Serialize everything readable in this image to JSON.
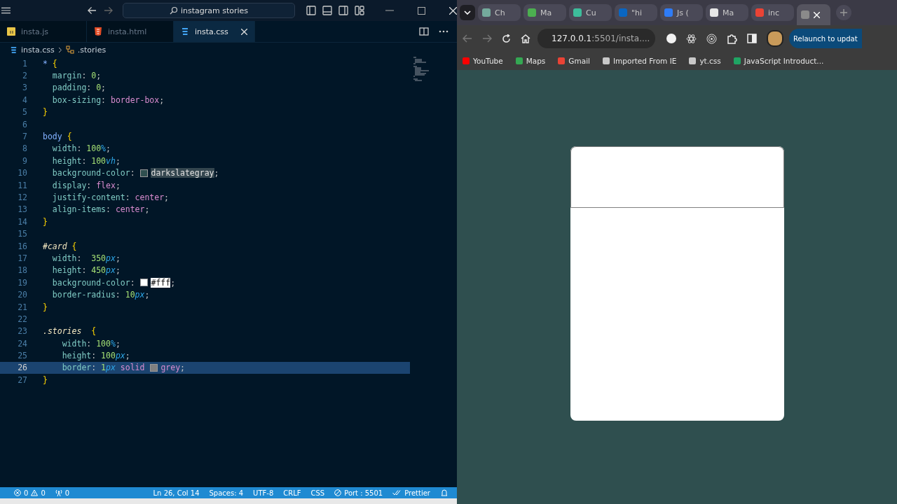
{
  "editor": {
    "search": "instagram stories",
    "tabs": [
      {
        "label": "insta.js",
        "kind": "js",
        "selected": false
      },
      {
        "label": "insta.html",
        "kind": "html",
        "selected": false
      },
      {
        "label": "insta.css",
        "kind": "css",
        "selected": true
      }
    ],
    "breadcrumb": {
      "file": "insta.css",
      "symbol": ".stories"
    },
    "lines": [
      {
        "num": "1",
        "selected": false,
        "tokens": [
          {
            "text": "*",
            "kind": "tag"
          },
          {
            "text": " {",
            "kind": "brace"
          }
        ]
      },
      {
        "num": "2",
        "selected": false,
        "tokens": [
          {
            "text": "  margin",
            "kind": "prop"
          },
          {
            "text": ": ",
            "kind": "punct"
          },
          {
            "text": "0",
            "kind": "num"
          },
          {
            "text": ";",
            "kind": "punct"
          }
        ]
      },
      {
        "num": "3",
        "selected": false,
        "tokens": [
          {
            "text": "  padding",
            "kind": "prop"
          },
          {
            "text": ": ",
            "kind": "punct"
          },
          {
            "text": "0",
            "kind": "num"
          },
          {
            "text": ";",
            "kind": "punct"
          }
        ]
      },
      {
        "num": "4",
        "selected": false,
        "tokens": [
          {
            "text": "  box-sizing",
            "kind": "prop"
          },
          {
            "text": ": ",
            "kind": "punct"
          },
          {
            "text": "border-box",
            "kind": "kw"
          },
          {
            "text": ";",
            "kind": "punct"
          }
        ]
      },
      {
        "num": "5",
        "selected": false,
        "tokens": [
          {
            "text": "}",
            "kind": "brace"
          }
        ]
      },
      {
        "num": "6",
        "selected": false
      },
      {
        "num": "7",
        "selected": false,
        "tokens": [
          {
            "text": "body",
            "kind": "tag"
          },
          {
            "text": " {",
            "kind": "brace"
          }
        ]
      },
      {
        "num": "8",
        "selected": false,
        "tokens": [
          {
            "text": "  width",
            "kind": "prop"
          },
          {
            "text": ": ",
            "kind": "punct"
          },
          {
            "text": "100",
            "kind": "num"
          },
          {
            "text": "%",
            "kind": "unit"
          },
          {
            "text": ";",
            "kind": "punct"
          }
        ]
      },
      {
        "num": "9",
        "selected": false,
        "tokens": [
          {
            "text": "  height",
            "kind": "prop"
          },
          {
            "text": ": ",
            "kind": "punct"
          },
          {
            "text": "100",
            "kind": "num"
          },
          {
            "text": "vh",
            "kind": "unit"
          },
          {
            "text": ";",
            "kind": "punct"
          }
        ]
      },
      {
        "num": "10",
        "selected": false,
        "tokens": [
          {
            "text": "  background-color",
            "kind": "prop"
          },
          {
            "text": ": ",
            "kind": "punct"
          },
          {
            "kind": "swatch",
            "color": "#2f4f4f"
          },
          {
            "text": "darkslategray",
            "kind": "marked"
          },
          {
            "text": ";",
            "kind": "punct"
          }
        ]
      },
      {
        "num": "11",
        "selected": false,
        "tokens": [
          {
            "text": "  display",
            "kind": "prop"
          },
          {
            "text": ": ",
            "kind": "punct"
          },
          {
            "text": "flex",
            "kind": "kw"
          },
          {
            "text": ";",
            "kind": "punct"
          }
        ]
      },
      {
        "num": "12",
        "selected": false,
        "tokens": [
          {
            "text": "  justify-content",
            "kind": "prop"
          },
          {
            "text": ": ",
            "kind": "punct"
          },
          {
            "text": "center",
            "kind": "kw"
          },
          {
            "text": ";",
            "kind": "punct"
          }
        ]
      },
      {
        "num": "13",
        "selected": false,
        "tokens": [
          {
            "text": "  align-items",
            "kind": "prop"
          },
          {
            "text": ": ",
            "kind": "punct"
          },
          {
            "text": "center",
            "kind": "kw"
          },
          {
            "text": ";",
            "kind": "punct"
          }
        ]
      },
      {
        "num": "14",
        "selected": false,
        "tokens": [
          {
            "text": "}",
            "kind": "brace"
          }
        ]
      },
      {
        "num": "15",
        "selected": false
      },
      {
        "num": "16",
        "selected": false,
        "tokens": [
          {
            "text": "#card",
            "kind": "sel"
          },
          {
            "text": " {",
            "kind": "brace"
          }
        ]
      },
      {
        "num": "17",
        "selected": false,
        "tokens": [
          {
            "text": "  width",
            "kind": "prop"
          },
          {
            "text": ":  ",
            "kind": "punct"
          },
          {
            "text": "350",
            "kind": "num"
          },
          {
            "text": "px",
            "kind": "unit"
          },
          {
            "text": ";",
            "kind": "punct"
          }
        ]
      },
      {
        "num": "18",
        "selected": false,
        "tokens": [
          {
            "text": "  height",
            "kind": "prop"
          },
          {
            "text": ": ",
            "kind": "punct"
          },
          {
            "text": "450",
            "kind": "num"
          },
          {
            "text": "px",
            "kind": "unit"
          },
          {
            "text": ";",
            "kind": "punct"
          }
        ]
      },
      {
        "num": "19",
        "selected": false,
        "tokens": [
          {
            "text": "  background-color",
            "kind": "prop"
          },
          {
            "text": ": ",
            "kind": "punct"
          },
          {
            "kind": "swatch",
            "color": "#ffffff"
          },
          {
            "text": "#fff",
            "kind": "marked-light"
          },
          {
            "text": ";",
            "kind": "punct"
          }
        ]
      },
      {
        "num": "20",
        "selected": false,
        "tokens": [
          {
            "text": "  border-radius",
            "kind": "prop"
          },
          {
            "text": ": ",
            "kind": "punct"
          },
          {
            "text": "10",
            "kind": "num"
          },
          {
            "text": "px",
            "kind": "unit"
          },
          {
            "text": ";",
            "kind": "punct"
          }
        ]
      },
      {
        "num": "21",
        "selected": false,
        "tokens": [
          {
            "text": "}",
            "kind": "brace"
          }
        ]
      },
      {
        "num": "22",
        "selected": false
      },
      {
        "num": "23",
        "selected": false,
        "tokens": [
          {
            "text": ".stories",
            "kind": "sel"
          },
          {
            "text": "  {",
            "kind": "brace"
          }
        ]
      },
      {
        "num": "24",
        "selected": false,
        "tokens": [
          {
            "text": "    width",
            "kind": "prop"
          },
          {
            "text": ": ",
            "kind": "punct"
          },
          {
            "text": "100",
            "kind": "num"
          },
          {
            "text": "%",
            "kind": "unit"
          },
          {
            "text": ";",
            "kind": "punct"
          }
        ]
      },
      {
        "num": "25",
        "selected": false,
        "tokens": [
          {
            "text": "    height",
            "kind": "prop"
          },
          {
            "text": ": ",
            "kind": "punct"
          },
          {
            "text": "100",
            "kind": "num"
          },
          {
            "text": "px",
            "kind": "unit"
          },
          {
            "text": ";",
            "kind": "punct"
          }
        ]
      },
      {
        "num": "26",
        "selected": true,
        "tokens": [
          {
            "text": "    border",
            "kind": "prop"
          },
          {
            "text": ": ",
            "kind": "punct"
          },
          {
            "text": "1",
            "kind": "num"
          },
          {
            "text": "px",
            "kind": "unit"
          },
          {
            "text": " solid ",
            "kind": "kw"
          },
          {
            "kind": "swatch",
            "color": "#808080"
          },
          {
            "text": "grey",
            "kind": "kw"
          },
          {
            "text": ";",
            "kind": "punct"
          }
        ]
      },
      {
        "num": "27",
        "selected": false,
        "tokens": [
          {
            "text": "}",
            "kind": "brace"
          }
        ]
      }
    ],
    "status": {
      "errors": "0",
      "warnings": "0",
      "ports": "0",
      "items": [
        {
          "text": "Ln 26, Col 14",
          "kind": "plain"
        },
        {
          "text": "Spaces: 4",
          "kind": "plain"
        },
        {
          "text": "UTF-8",
          "kind": "plain"
        },
        {
          "text": "CRLF",
          "kind": "plain"
        },
        {
          "text": "CSS",
          "kind": "plain"
        },
        {
          "text": "Port : 5501",
          "kind": "port"
        },
        {
          "text": "Prettier",
          "kind": "check"
        }
      ]
    }
  },
  "browser": {
    "tabs": [
      {
        "label": "Ch",
        "color": "#74aa9c",
        "selected": false
      },
      {
        "label": "Ma",
        "color": "#4caf50",
        "selected": false
      },
      {
        "label": "Cu",
        "color": "#3dbd9b",
        "selected": false
      },
      {
        "label": "\"hi",
        "color": "#0a66c2",
        "selected": false
      },
      {
        "label": "Js (",
        "color": "#2f7cf6",
        "selected": false
      },
      {
        "label": "Ma",
        "color": "#e6e6e6",
        "selected": false
      },
      {
        "label": "inc",
        "color": "#ea4335",
        "selected": false
      },
      {
        "color": "#8a8a8a",
        "selected": true
      }
    ],
    "url_host": "127.0.0.1",
    "url_rest": ":5501/insta....",
    "relaunch": "Relaunch to updat",
    "bookmarks": [
      {
        "label": "YouTube",
        "color": "#ff0000"
      },
      {
        "label": "Maps",
        "color": "#34a853"
      },
      {
        "label": "Gmail",
        "color": "#ea4335"
      },
      {
        "label": "Imported From IE",
        "color": "#c8c8c8"
      },
      {
        "label": "yt.css",
        "color": "#c8c8c8"
      },
      {
        "label": "JavaScript Introduct...",
        "color": "#1fa463"
      }
    ]
  }
}
